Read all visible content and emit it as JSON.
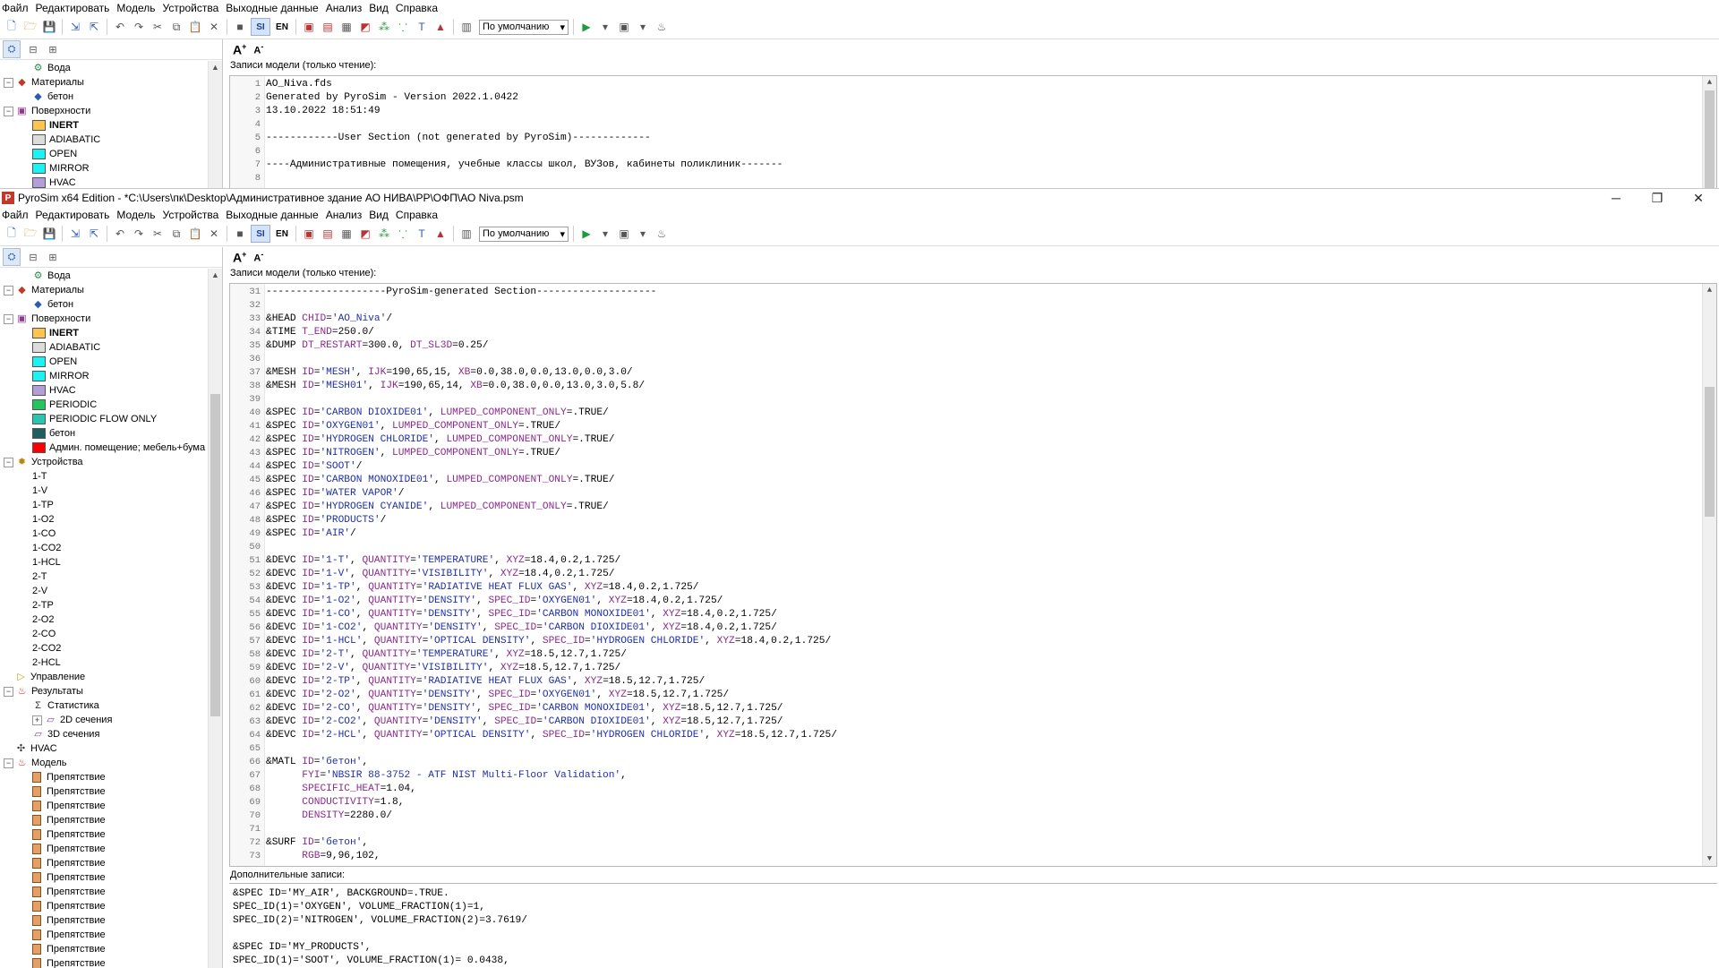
{
  "menu": [
    "Файл",
    "Редактировать",
    "Модель",
    "Устройства",
    "Выходные данные",
    "Анализ",
    "Вид",
    "Справка"
  ],
  "toolbar": {
    "si_label": "SI",
    "en_label": "EN",
    "combo_value": "По умолчанию"
  },
  "window2_title": "PyroSim x64 Edition - *C:\\Users\\пк\\Desktop\\Административное здание АО НИВА\\РР\\ОФП\\АО Niva.psm",
  "window_controls": [
    "─",
    "❐",
    "✕"
  ],
  "section_labels": {
    "model_records": "Записи модели (только чтение):",
    "extra_records": "Дополнительные записи:"
  },
  "tree_top": [
    {
      "kind": "leaf2",
      "label": "Вода",
      "icon": "gear-icon"
    },
    {
      "kind": "group",
      "label": "Материалы",
      "icon": "materials-icon",
      "expanded": true
    },
    {
      "kind": "leaf1",
      "label": "бетон",
      "icon": "material-icon"
    },
    {
      "kind": "group",
      "label": "Поверхности",
      "icon": "surfaces-icon",
      "expanded": true
    },
    {
      "kind": "surface",
      "label": "INERT",
      "color": "#ffc44f",
      "bold": true
    },
    {
      "kind": "surface",
      "label": "ADIABATIC",
      "color": "#dcdcdc"
    },
    {
      "kind": "surface",
      "label": "OPEN",
      "color": "#19f3f3"
    },
    {
      "kind": "surface",
      "label": "MIRROR",
      "color": "#19f3f3"
    },
    {
      "kind": "surface",
      "label": "HVAC",
      "color": "#b39ddb"
    }
  ],
  "tree_main": [
    {
      "kind": "leaf2",
      "label": "Вода",
      "icon": "gear-icon"
    },
    {
      "kind": "group",
      "label": "Материалы",
      "icon": "materials-icon",
      "expanded": true
    },
    {
      "kind": "leaf1",
      "label": "бетон",
      "icon": "material-icon"
    },
    {
      "kind": "group",
      "label": "Поверхности",
      "icon": "surfaces-icon",
      "expanded": true
    },
    {
      "kind": "surface",
      "label": "INERT",
      "color": "#ffc44f",
      "bold": true
    },
    {
      "kind": "surface",
      "label": "ADIABATIC",
      "color": "#dcdcdc"
    },
    {
      "kind": "surface",
      "label": "OPEN",
      "color": "#19f3f3"
    },
    {
      "kind": "surface",
      "label": "MIRROR",
      "color": "#19f3f3"
    },
    {
      "kind": "surface",
      "label": "HVAC",
      "color": "#b39ddb"
    },
    {
      "kind": "surface",
      "label": "PERIODIC",
      "color": "#22c55e"
    },
    {
      "kind": "surface",
      "label": "PERIODIC FLOW ONLY",
      "color": "#26c6b0"
    },
    {
      "kind": "surface",
      "label": "бетон",
      "color": "#1f5f5f"
    },
    {
      "kind": "surface",
      "label": "Админ. помещение; мебель+бума",
      "color": "#ff0000"
    },
    {
      "kind": "group",
      "label": "Устройства",
      "icon": "devices-icon",
      "expanded": true
    },
    {
      "kind": "device",
      "label": "1-T"
    },
    {
      "kind": "device",
      "label": "1-V"
    },
    {
      "kind": "device",
      "label": "1-TP"
    },
    {
      "kind": "device",
      "label": "1-O2"
    },
    {
      "kind": "device",
      "label": "1-CO"
    },
    {
      "kind": "device",
      "label": "1-CO2"
    },
    {
      "kind": "device",
      "label": "1-HCL"
    },
    {
      "kind": "device",
      "label": "2-T"
    },
    {
      "kind": "device",
      "label": "2-V"
    },
    {
      "kind": "device",
      "label": "2-TP"
    },
    {
      "kind": "device",
      "label": "2-O2"
    },
    {
      "kind": "device",
      "label": "2-CO"
    },
    {
      "kind": "device",
      "label": "2-CO2"
    },
    {
      "kind": "device",
      "label": "2-HCL"
    },
    {
      "kind": "group0",
      "label": "Управление",
      "icon": "control-icon"
    },
    {
      "kind": "group",
      "label": "Результаты",
      "icon": "results-icon",
      "expanded": true
    },
    {
      "kind": "leaf1",
      "label": "Статистика",
      "icon": "statistics-icon"
    },
    {
      "kind": "sub",
      "label": "2D сечения",
      "icon": "slice2d-icon"
    },
    {
      "kind": "leaf1",
      "label": "3D сечения",
      "icon": "slice3d-icon"
    },
    {
      "kind": "group0",
      "label": "HVAC",
      "icon": "hvac-icon"
    },
    {
      "kind": "group",
      "label": "Модель",
      "icon": "model-icon",
      "expanded": true
    },
    {
      "kind": "obst",
      "label": "Препятствие"
    },
    {
      "kind": "obst",
      "label": "Препятствие"
    },
    {
      "kind": "obst",
      "label": "Препятствие"
    },
    {
      "kind": "obst",
      "label": "Препятствие"
    },
    {
      "kind": "obst",
      "label": "Препятствие"
    },
    {
      "kind": "obst",
      "label": "Препятствие"
    },
    {
      "kind": "obst",
      "label": "Препятствие"
    },
    {
      "kind": "obst",
      "label": "Препятствие"
    },
    {
      "kind": "obst",
      "label": "Препятствие"
    },
    {
      "kind": "obst",
      "label": "Препятствие"
    },
    {
      "kind": "obst",
      "label": "Препятствие"
    },
    {
      "kind": "obst",
      "label": "Препятствие"
    },
    {
      "kind": "obst",
      "label": "Препятствие"
    },
    {
      "kind": "obst",
      "label": "Препятствие"
    }
  ],
  "code_top": [
    {
      "n": "1",
      "t": "AO_Niva.fds"
    },
    {
      "n": "2",
      "t": "Generated by PyroSim - Version 2022.1.0422"
    },
    {
      "n": "3",
      "t": "13.10.2022 18:51:49"
    },
    {
      "n": "4",
      "t": ""
    },
    {
      "n": "5",
      "t": "------------User Section (not generated by PyroSim)-------------"
    },
    {
      "n": "6",
      "t": ""
    },
    {
      "n": "7",
      "t": "----Административные помещения, учебные классы школ, ВУЗов, кабинеты поликлиник-------"
    },
    {
      "n": "8",
      "t": ""
    }
  ],
  "code_main": [
    {
      "n": "31",
      "t": "--------------------PyroSim-generated Section--------------------"
    },
    {
      "n": "32",
      "t": ""
    },
    {
      "n": "33",
      "t": "&HEAD CHID='AO_Niva'/"
    },
    {
      "n": "34",
      "t": "&TIME T_END=250.0/"
    },
    {
      "n": "35",
      "t": "&DUMP DT_RESTART=300.0, DT_SL3D=0.25/"
    },
    {
      "n": "36",
      "t": ""
    },
    {
      "n": "37",
      "t": "&MESH ID='MESH', IJK=190,65,15, XB=0.0,38.0,0.0,13.0,0.0,3.0/"
    },
    {
      "n": "38",
      "t": "&MESH ID='MESH01', IJK=190,65,14, XB=0.0,38.0,0.0,13.0,3.0,5.8/"
    },
    {
      "n": "39",
      "t": ""
    },
    {
      "n": "40",
      "t": "&SPEC ID='CARBON DIOXIDE01', LUMPED_COMPONENT_ONLY=.TRUE/"
    },
    {
      "n": "41",
      "t": "&SPEC ID='OXYGEN01', LUMPED_COMPONENT_ONLY=.TRUE/"
    },
    {
      "n": "42",
      "t": "&SPEC ID='HYDROGEN CHLORIDE', LUMPED_COMPONENT_ONLY=.TRUE/"
    },
    {
      "n": "43",
      "t": "&SPEC ID='NITROGEN', LUMPED_COMPONENT_ONLY=.TRUE/"
    },
    {
      "n": "44",
      "t": "&SPEC ID='SOOT'/"
    },
    {
      "n": "45",
      "t": "&SPEC ID='CARBON MONOXIDE01', LUMPED_COMPONENT_ONLY=.TRUE/"
    },
    {
      "n": "46",
      "t": "&SPEC ID='WATER VAPOR'/"
    },
    {
      "n": "47",
      "t": "&SPEC ID='HYDROGEN CYANIDE', LUMPED_COMPONENT_ONLY=.TRUE/"
    },
    {
      "n": "48",
      "t": "&SPEC ID='PRODUCTS'/"
    },
    {
      "n": "49",
      "t": "&SPEC ID='AIR'/"
    },
    {
      "n": "50",
      "t": ""
    },
    {
      "n": "51",
      "t": "&DEVC ID='1-T', QUANTITY='TEMPERATURE', XYZ=18.4,0.2,1.725/"
    },
    {
      "n": "52",
      "t": "&DEVC ID='1-V', QUANTITY='VISIBILITY', XYZ=18.4,0.2,1.725/"
    },
    {
      "n": "53",
      "t": "&DEVC ID='1-TP', QUANTITY='RADIATIVE HEAT FLUX GAS', XYZ=18.4,0.2,1.725/"
    },
    {
      "n": "54",
      "t": "&DEVC ID='1-O2', QUANTITY='DENSITY', SPEC_ID='OXYGEN01', XYZ=18.4,0.2,1.725/"
    },
    {
      "n": "55",
      "t": "&DEVC ID='1-CO', QUANTITY='DENSITY', SPEC_ID='CARBON MONOXIDE01', XYZ=18.4,0.2,1.725/"
    },
    {
      "n": "56",
      "t": "&DEVC ID='1-CO2', QUANTITY='DENSITY', SPEC_ID='CARBON DIOXIDE01', XYZ=18.4,0.2,1.725/"
    },
    {
      "n": "57",
      "t": "&DEVC ID='1-HCL', QUANTITY='OPTICAL DENSITY', SPEC_ID='HYDROGEN CHLORIDE', XYZ=18.4,0.2,1.725/"
    },
    {
      "n": "58",
      "t": "&DEVC ID='2-T', QUANTITY='TEMPERATURE', XYZ=18.5,12.7,1.725/"
    },
    {
      "n": "59",
      "t": "&DEVC ID='2-V', QUANTITY='VISIBILITY', XYZ=18.5,12.7,1.725/"
    },
    {
      "n": "60",
      "t": "&DEVC ID='2-TP', QUANTITY='RADIATIVE HEAT FLUX GAS', XYZ=18.5,12.7,1.725/"
    },
    {
      "n": "61",
      "t": "&DEVC ID='2-O2', QUANTITY='DENSITY', SPEC_ID='OXYGEN01', XYZ=18.5,12.7,1.725/"
    },
    {
      "n": "62",
      "t": "&DEVC ID='2-CO', QUANTITY='DENSITY', SPEC_ID='CARBON MONOXIDE01', XYZ=18.5,12.7,1.725/"
    },
    {
      "n": "63",
      "t": "&DEVC ID='2-CO2', QUANTITY='DENSITY', SPEC_ID='CARBON DIOXIDE01', XYZ=18.5,12.7,1.725/"
    },
    {
      "n": "64",
      "t": "&DEVC ID='2-HCL', QUANTITY='OPTICAL DENSITY', SPEC_ID='HYDROGEN CHLORIDE', XYZ=18.5,12.7,1.725/"
    },
    {
      "n": "65",
      "t": ""
    },
    {
      "n": "66",
      "t": "&MATL ID='бетон',"
    },
    {
      "n": "67",
      "t": "      FYI='NBSIR 88-3752 - ATF NIST Multi-Floor Validation',"
    },
    {
      "n": "68",
      "t": "      SPECIFIC_HEAT=1.04,"
    },
    {
      "n": "69",
      "t": "      CONDUCTIVITY=1.8,"
    },
    {
      "n": "70",
      "t": "      DENSITY=2280.0/"
    },
    {
      "n": "71",
      "t": ""
    },
    {
      "n": "72",
      "t": "&SURF ID='бетон',"
    },
    {
      "n": "73",
      "t": "      RGB=9,96,102,"
    }
  ],
  "extra_records": [
    "&SPEC ID='MY_AIR', BACKGROUND=.TRUE.",
    "SPEC_ID(1)='OXYGEN', VOLUME_FRACTION(1)=1,",
    "SPEC_ID(2)='NITROGEN', VOLUME_FRACTION(2)=3.7619/",
    "",
    "&SPEC ID='MY_PRODUCTS',",
    "SPEC_ID(1)='SOOT', VOLUME_FRACTION(1)= 0.0438,"
  ],
  "colors": {
    "keyword": "#8b2a8b",
    "string": "#1f2fa8",
    "accent": "#1a3f9e"
  }
}
